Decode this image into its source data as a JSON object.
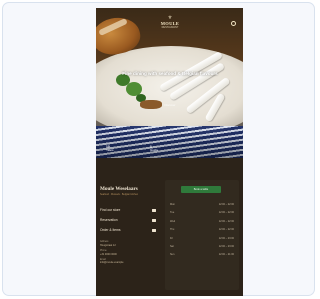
{
  "site": {
    "logo": {
      "name": "MOULE",
      "sub": "RESTAURANT"
    },
    "hero": {
      "tagline": "Fine dining with seafood & Belgian flavours",
      "scroll_label": "Discover",
      "stats": [
        {
          "value": "10",
          "label": "Years"
        },
        {
          "value": "1",
          "label": "Guide"
        }
      ]
    },
    "footer": {
      "title": "Moule Weselaars",
      "subtitle": "Seafood · Mussels · Belgian kitchen",
      "links": [
        "Find our store",
        "Reservation",
        "Order & Items"
      ],
      "address": [
        {
          "label": "Address",
          "value": "Hoogstraat 12"
        },
        {
          "label": "Phone",
          "value": "+31 0000 0000"
        },
        {
          "label": "Email",
          "value": "info@moule.example"
        }
      ],
      "reserve_button": "Book a table",
      "hours": [
        {
          "day": "Mon",
          "time": "12:00 – 22:00"
        },
        {
          "day": "Tue",
          "time": "12:00 – 22:00"
        },
        {
          "day": "Wed",
          "time": "12:00 – 22:00"
        },
        {
          "day": "Thu",
          "time": "12:00 – 22:00"
        },
        {
          "day": "Fri",
          "time": "12:00 – 23:00"
        },
        {
          "day": "Sat",
          "time": "12:00 – 23:00"
        },
        {
          "day": "Sun",
          "time": "12:00 – 21:00"
        }
      ]
    }
  },
  "colors": {
    "accent": "#2f7a3b",
    "footer_bg": "#2c2319",
    "brand_gold": "#b38f5e"
  }
}
